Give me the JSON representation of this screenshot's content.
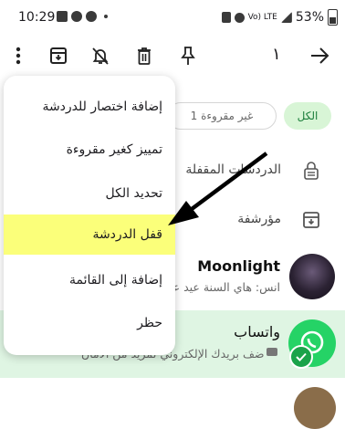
{
  "status": {
    "time": "10:29",
    "battery": "53%",
    "network": "Vo) LTE"
  },
  "toolbar": {
    "selected_count": "١"
  },
  "filters": {
    "all": "الكل",
    "unread": "غير مقروءة 1"
  },
  "rows": {
    "locked": "الدردشات المقفلة",
    "archived": "مؤرشفة"
  },
  "chats": [
    {
      "name": "Moonlight",
      "preview": "انس: هاي السنة عيد عيد"
    },
    {
      "name": "واتساب",
      "preview": "أضف بريدك الإلكتروني لمزيد من الأمان"
    }
  ],
  "menu": {
    "items": [
      {
        "label": "إضافة اختصار للدردشة"
      },
      {
        "label": "تمييز كغير مقروءة"
      },
      {
        "label": "تحديد الكل"
      },
      {
        "label": "قفل الدردشة"
      },
      {
        "label": "إضافة إلى القائمة"
      },
      {
        "label": "حظر"
      }
    ]
  },
  "colors": {
    "highlight": "#fbff7a",
    "selected_bg": "#dff5e3",
    "whatsapp_green": "#25d366",
    "chip_bg": "#d8f5d6"
  }
}
